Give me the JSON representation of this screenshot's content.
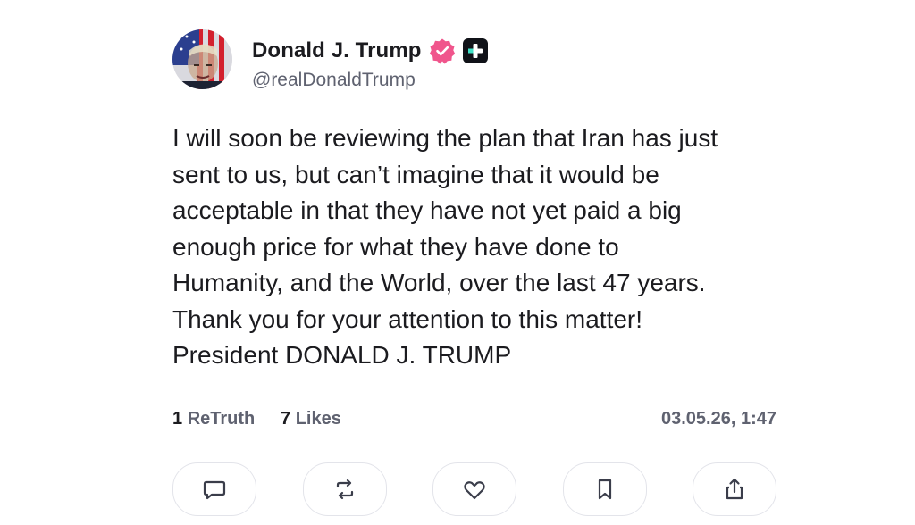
{
  "author": {
    "name": "Donald J. Trump",
    "handle": "@realDonaldTrump",
    "verified_icon": "verified-badge-icon",
    "plus_icon": "truth-plus-icon",
    "verified_color": "#f0558c"
  },
  "post": {
    "lines": [
      "I will soon be reviewing the plan that Iran has just",
      "sent to us, but can’t imagine that it would be",
      "acceptable in that they have not yet paid a big",
      "enough price for what they have done to",
      "Humanity, and the World, over the last 47 years.",
      "Thank you for your attention to this matter!",
      "President DONALD J. TRUMP"
    ]
  },
  "stats": {
    "retruths_count": "1",
    "retruths_label": "ReTruth",
    "likes_count": "7",
    "likes_label": "Likes",
    "timestamp": "03.05.26, 1:47"
  },
  "actions": [
    {
      "icon": "comment-icon"
    },
    {
      "icon": "retruth-icon"
    },
    {
      "icon": "like-heart-icon"
    },
    {
      "icon": "bookmark-icon"
    },
    {
      "icon": "share-icon"
    }
  ]
}
